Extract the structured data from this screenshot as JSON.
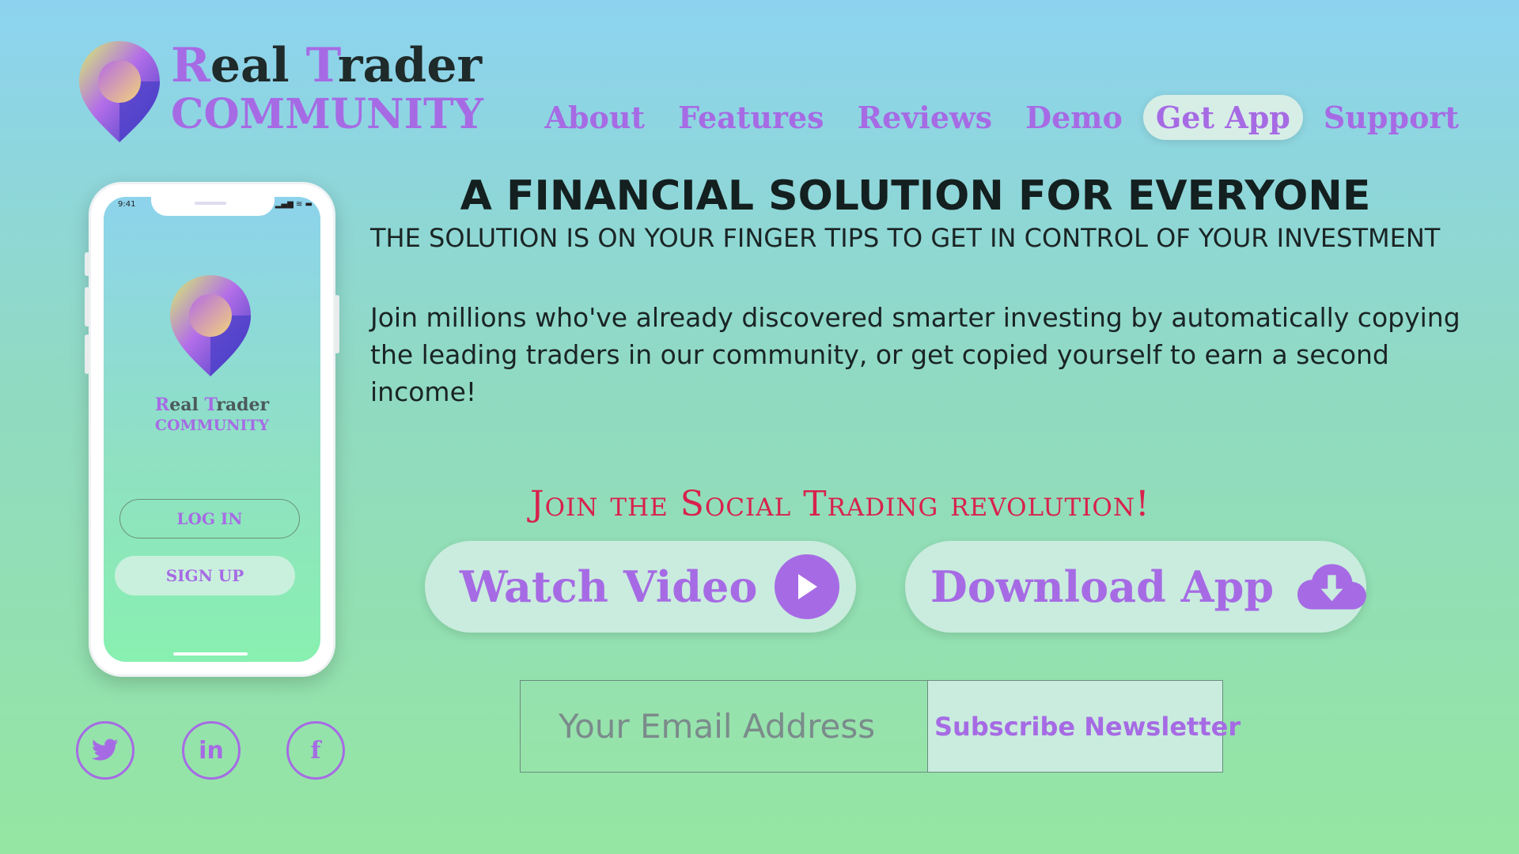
{
  "brand": {
    "line1_first_initial": "R",
    "line1_first_rest": "eal ",
    "line1_second_initial": "T",
    "line1_second_rest": "rader",
    "line2": "COMMUNITY"
  },
  "nav": {
    "items": [
      {
        "label": "About"
      },
      {
        "label": "Features"
      },
      {
        "label": "Reviews"
      },
      {
        "label": "Demo"
      },
      {
        "label": "Get App"
      },
      {
        "label": "Support"
      }
    ],
    "active": "Get App"
  },
  "phone": {
    "status_time": "9:41",
    "status_icons": "▂▄▆ ≋ ▬",
    "login_label": "LOG IN",
    "signup_label": "SIGN UP"
  },
  "social": {
    "icons": [
      "twitter-icon",
      "linkedin-icon",
      "facebook-icon"
    ],
    "linkedin_glyph": "in",
    "facebook_glyph": "f"
  },
  "hero": {
    "title": "A FINANCIAL SOLUTION FOR EVERYONE",
    "subtitle": "THE SOLUTION IS  ON YOUR FINGER TIPS TO GET IN CONTROL OF YOUR INVESTMENT",
    "description": "Join millions who've already discovered smarter investing by automatically copying the leading traders in our community, or get copied yourself to earn a second income!"
  },
  "tagline": "Join the Social Trading revolution!",
  "cta": {
    "watch_video": "Watch Video",
    "download_app": "Download App"
  },
  "newsletter": {
    "placeholder": "Your Email Address",
    "button": "Subscribe Newsletter"
  },
  "colors": {
    "accent": "#a66be4",
    "tagline": "#d8214c",
    "button_bg": "#c9ecde"
  }
}
